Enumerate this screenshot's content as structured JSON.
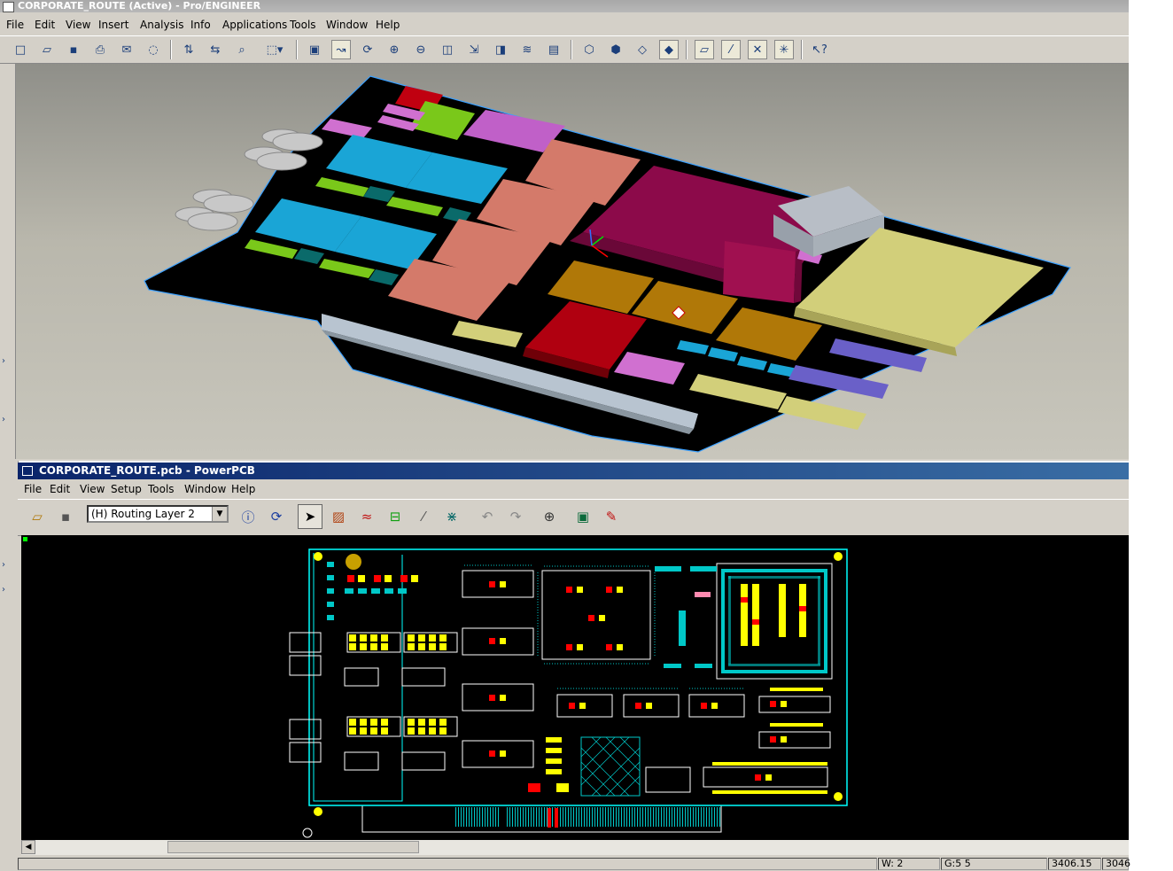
{
  "proe": {
    "title": "CORPORATE_ROUTE (Active) - Pro/ENGINEER",
    "menu": [
      "File",
      "Edit",
      "View",
      "Insert",
      "Analysis",
      "Info",
      "Applications",
      "Tools",
      "Window",
      "Help"
    ]
  },
  "pcb": {
    "title": "CORPORATE_ROUTE.pcb - PowerPCB",
    "menu": [
      "File",
      "Edit",
      "View",
      "Setup",
      "Tools",
      "Window",
      "Help"
    ],
    "layer": "(H) Routing Layer 2",
    "status": {
      "w": "W: 2",
      "g": "G:5 5",
      "x": "3406.15",
      "y": "3046"
    }
  },
  "colors": {
    "pcb_board_outline": "#00ffff",
    "pad_yellow": "#ffff00",
    "pad_red": "#ff0000",
    "proe_board": "#000000",
    "proe_cyan_ic": "#1aa5d6",
    "proe_salmon_ic": "#d47a6a",
    "proe_magenta_ic": "#8c0a4a",
    "proe_gold_ic": "#b07808",
    "proe_yellow_ic": "#d2cf7a"
  },
  "icons": {
    "proe_toolbar": [
      "new-icon",
      "open-icon",
      "save-icon",
      "print-icon",
      "send-icon",
      "erase-icon",
      "regen-icon",
      "datum-icon",
      "find-icon",
      "select-box-icon",
      "repaint-icon",
      "spin-icon",
      "orient-icon",
      "zoom-in-icon",
      "zoom-out-icon",
      "refit-icon",
      "view-manager-icon",
      "saved-views-icon",
      "layers-icon",
      "model-tree-icon",
      "wireframe-icon",
      "hidden-line-icon",
      "no-hidden-icon",
      "shading-icon",
      "datum-planes-icon",
      "datum-axes-icon",
      "datum-points-icon",
      "coordinate-systems-icon",
      "whats-this-icon"
    ],
    "pcb_toolbar": [
      "open-icon",
      "save-icon",
      "info-icon",
      "cycle-icon",
      "select-icon",
      "drafting-icon",
      "routing-icon",
      "dimension-icon",
      "ecc-icon",
      "bga-icon",
      "undo-icon",
      "redo-icon",
      "zoom-icon",
      "verify-icon",
      "cam-icon"
    ]
  }
}
